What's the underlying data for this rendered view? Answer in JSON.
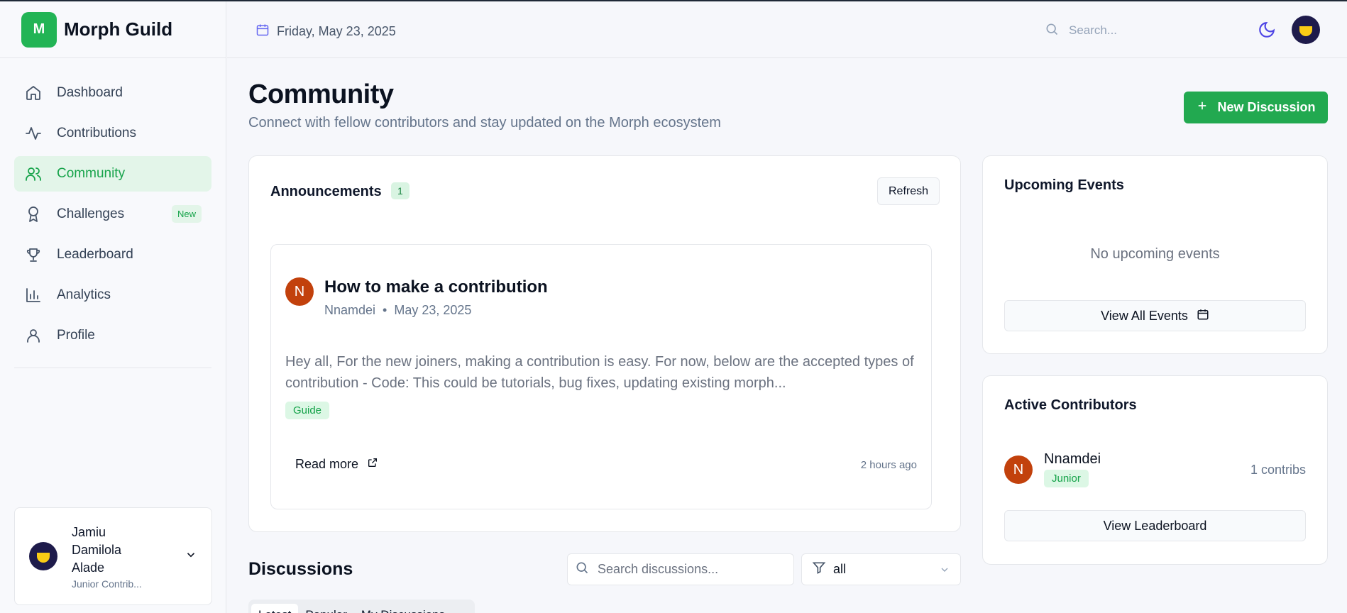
{
  "brand": {
    "logo_letter": "M",
    "name": "Morph Guild"
  },
  "sidebar": {
    "items": [
      {
        "label": "Dashboard",
        "icon": "home-icon"
      },
      {
        "label": "Contributions",
        "icon": "activity-icon"
      },
      {
        "label": "Community",
        "icon": "users-icon",
        "active": true
      },
      {
        "label": "Challenges",
        "icon": "award-icon",
        "badge": "New"
      },
      {
        "label": "Leaderboard",
        "icon": "trophy-icon"
      },
      {
        "label": "Analytics",
        "icon": "bar-chart-icon"
      },
      {
        "label": "Profile",
        "icon": "user-icon"
      }
    ]
  },
  "user": {
    "name": "Jamiu Damilola Alade",
    "role": "Junior Contrib..."
  },
  "header": {
    "date": "Friday, May 23, 2025",
    "search_placeholder": "Search..."
  },
  "page": {
    "title": "Community",
    "subtitle": "Connect with fellow contributors and stay updated on the Morph ecosystem",
    "new_discussion_label": "New Discussion"
  },
  "announcements": {
    "title": "Announcements",
    "count": "1",
    "refresh_label": "Refresh",
    "post": {
      "avatar_letter": "N",
      "title": "How to make a contribution",
      "author": "Nnamdei",
      "separator": "•",
      "date": "May 23, 2025",
      "body": "Hey all, For the new joiners, making a contribution is easy. For now, below are the accepted types of contribution - Code: This could be tutorials, bug fixes, updating existing morph...",
      "tag": "Guide",
      "read_more_label": "Read more",
      "time_ago": "2 hours ago"
    }
  },
  "events": {
    "title": "Upcoming Events",
    "empty_text": "No upcoming events",
    "view_all_label": "View All Events"
  },
  "contributors": {
    "title": "Active Contributors",
    "items": [
      {
        "avatar_letter": "N",
        "name": "Nnamdei",
        "rank": "Junior",
        "count": "1 contribs"
      }
    ],
    "view_leaderboard_label": "View Leaderboard"
  },
  "discussions": {
    "title": "Discussions",
    "search_placeholder": "Search discussions...",
    "filter_value": "all",
    "tabs": [
      "Latest",
      "Popular",
      "My Discussions"
    ]
  },
  "colors": {
    "accent": "#22a950",
    "accent_light": "#e3f5e9",
    "avatar_orange": "#c2410c"
  }
}
